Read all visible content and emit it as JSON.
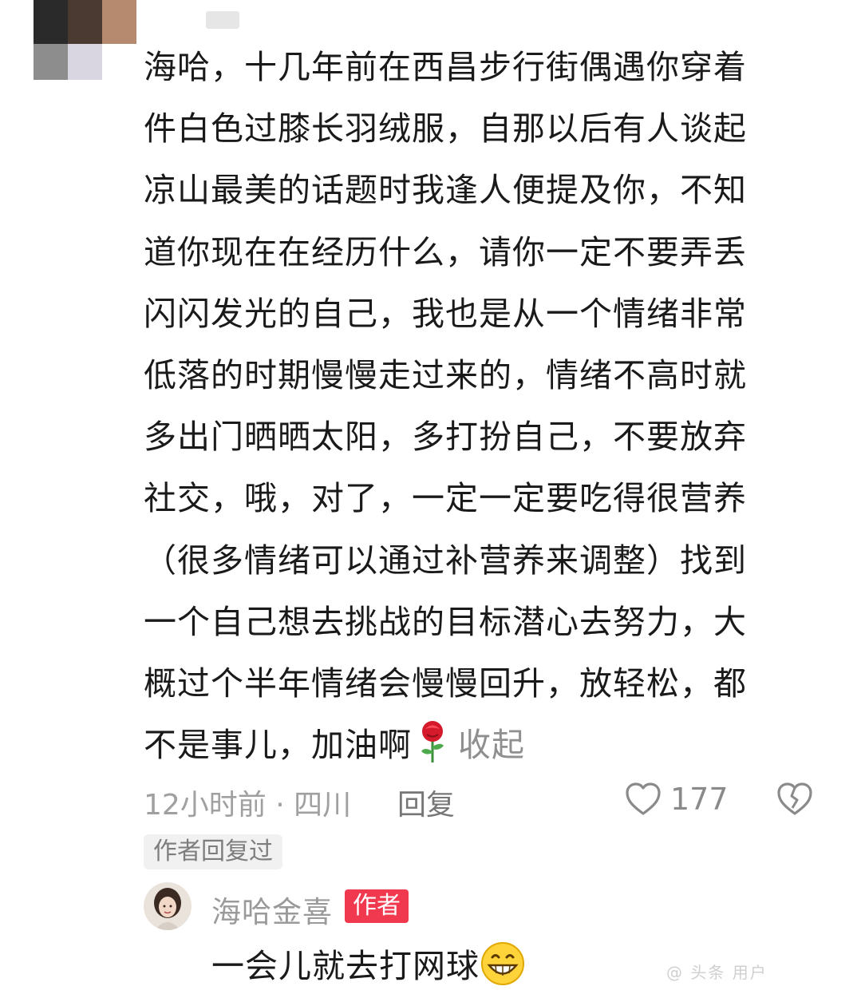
{
  "comment": {
    "lines": [
      "海哈，十几年前在西昌步行街偶遇你穿着",
      "件白色过膝长羽绒服，自那以后有人谈起",
      "凉山最美的话题时我逢人便提及你，不知",
      "道你现在在经历什么，请你一定不要弄丢",
      "闪闪发光的自己，我也是从一个情绪非常",
      "低落的时期慢慢走过来的，情绪不高时就",
      "多出门晒晒太阳，多打扮自己，不要放弃",
      "社交，哦，对了，一定一定要吃得很营养",
      "（很多情绪可以通过补营养来调整）找到",
      "一个自己想去挑战的目标潜心去努力，大",
      "概过个半年情绪会慢慢回升，放轻松，都"
    ],
    "last_line": "不是事儿，加油啊",
    "emoji_icon": "rose-icon",
    "collapse_label": "收起",
    "meta": "12小时前 · 四川",
    "reply_label": "回复",
    "like_count": "177",
    "author_replied_badge": "作者回复过"
  },
  "reply": {
    "username": "海哈金喜",
    "author_tag": "作者",
    "text": "一会儿就去打网球",
    "emoji_icon": "grin-icon"
  },
  "watermark": "@ 头条 用户",
  "colors": {
    "author_tag_bg": "#f0384f",
    "meta_gray": "#a0a0a0"
  }
}
